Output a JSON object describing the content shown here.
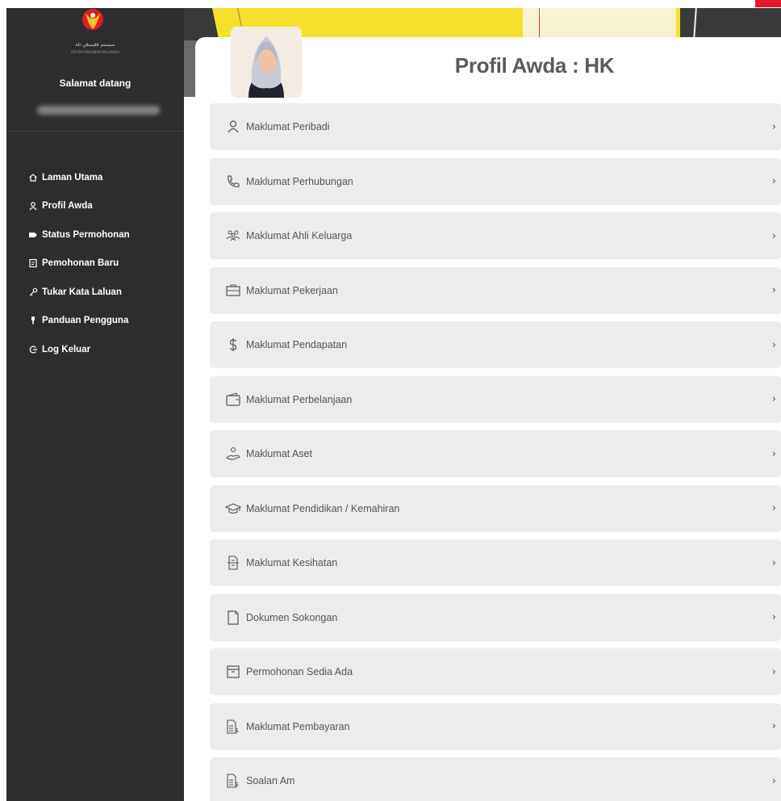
{
  "sidebar": {
    "logo_caption": "سيستم فڠيمبڠن تاه",
    "logo_subcaption": "SISTEM KEBAJIKAN KELUARGA",
    "welcome": "Salamat datang",
    "nav": [
      {
        "label": "Laman Utama",
        "icon": "home-icon"
      },
      {
        "label": "Profil Awda",
        "icon": "user-icon"
      },
      {
        "label": "Status Permohonan",
        "icon": "tag-icon"
      },
      {
        "label": "Pemohonan Baru",
        "icon": "form-icon"
      },
      {
        "label": "Tukar Kata Laluan",
        "icon": "key-icon"
      },
      {
        "label": "Panduan Pengguna",
        "icon": "info-icon"
      },
      {
        "label": "Log Keluar",
        "icon": "logout-icon"
      }
    ]
  },
  "header": {
    "title": "Profil Awda : HK"
  },
  "menu": [
    {
      "label": "Maklumat Peribadi",
      "icon": "person-icon"
    },
    {
      "label": "Maklumat Perhubungan",
      "icon": "phone-icon"
    },
    {
      "label": "Maklumat Ahli Keluarga",
      "icon": "family-icon"
    },
    {
      "label": "Maklumat Pekerjaan",
      "icon": "briefcase-icon"
    },
    {
      "label": "Maklumat Pendapatan",
      "icon": "dollar-icon"
    },
    {
      "label": "Maklumat Perbelanjaan",
      "icon": "wallet-icon"
    },
    {
      "label": "Maklumat Aset",
      "icon": "asset-icon"
    },
    {
      "label": "Maklumat Pendidikan / Kemahiran",
      "icon": "graduation-cap-icon"
    },
    {
      "label": "Maklumat Kesihatan",
      "icon": "health-record-icon"
    },
    {
      "label": "Dokumen Sokongan",
      "icon": "document-icon"
    },
    {
      "label": "Permohonan Sedia Ada",
      "icon": "archive-icon"
    },
    {
      "label": "Maklumat Pembayaran",
      "icon": "payment-icon"
    },
    {
      "label": "Soalan Am",
      "icon": "question-icon"
    }
  ],
  "chevron": "›",
  "colors": {
    "sidebar_bg": "#2d2d2d",
    "row_bg": "#ececec",
    "brand_yellow": "#f5e12b",
    "brand_red": "#e3192b"
  }
}
